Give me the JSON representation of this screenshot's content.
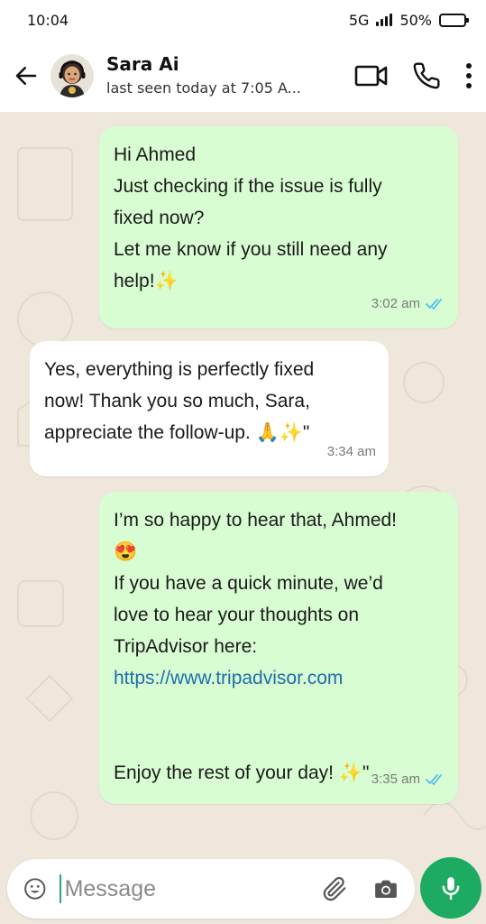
{
  "status_bar": {
    "time": "10:04",
    "network": "5G",
    "battery_text": "50%",
    "battery_level": 0.5
  },
  "header": {
    "contact_name": "Sara Ai",
    "last_seen": "last seen today at 7:05 A..."
  },
  "messages": [
    {
      "direction": "outgoing",
      "lines": [
        "Hi Ahmed",
        "Just checking if the issue is fully",
        "fixed now?",
        "Let me know if you still need any",
        "help!✨"
      ],
      "time": "3:02 am",
      "read": true
    },
    {
      "direction": "incoming",
      "lines": [
        "Yes, everything is perfectly fixed",
        "now! Thank you so much, Sara,",
        "appreciate the follow-up. 🙏✨\""
      ],
      "time": "3:34 am"
    },
    {
      "direction": "outgoing",
      "lines": [
        "I’m so happy to hear that, Ahmed!",
        "😍",
        "If you have a quick minute, we’d",
        "love to hear your thoughts on",
        "TripAdvisor here:"
      ],
      "link": "https://www.tripadvisor.com",
      "closing": "Enjoy the rest of your day! ✨\"",
      "time": "3:35 am",
      "read": true
    }
  ],
  "composer": {
    "placeholder": "Message"
  },
  "colors": {
    "outgoing_bubble": "#d9fdd3",
    "incoming_bubble": "#ffffff",
    "wallpaper": "#efe7dc",
    "accent_green": "#1daa61",
    "read_ticks": "#53bdeb",
    "link": "#1d6ea8"
  },
  "icons": {
    "back": "arrow-left-icon",
    "video": "video-camera-icon",
    "call": "phone-icon",
    "menu": "more-vertical-icon",
    "emoji": "emoji-icon",
    "attach": "paperclip-icon",
    "camera": "camera-icon",
    "mic": "microphone-icon"
  }
}
